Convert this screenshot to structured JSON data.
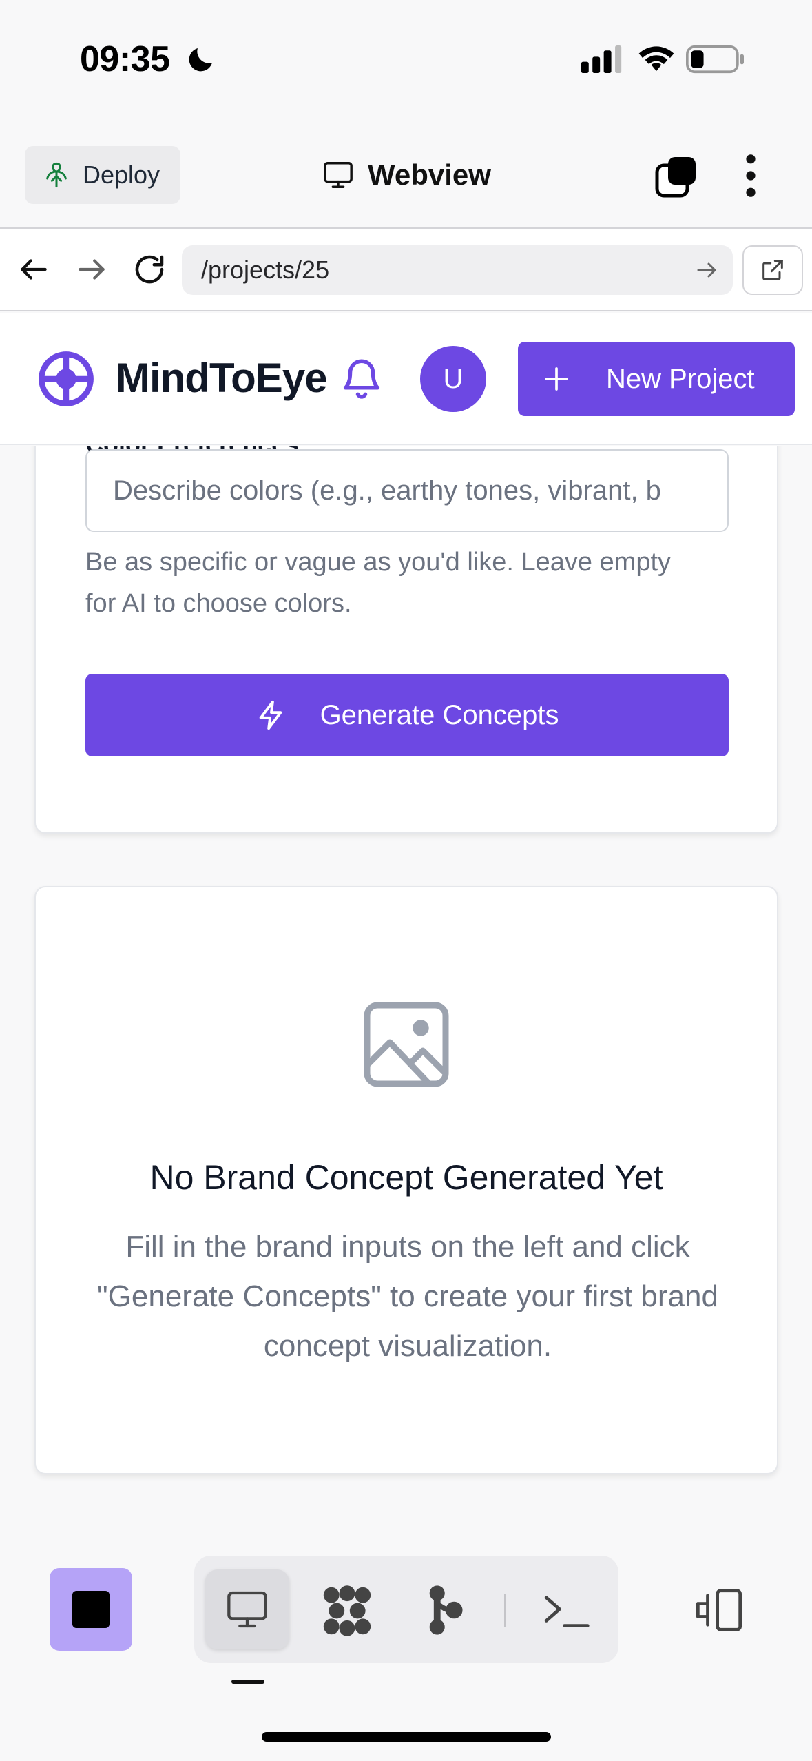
{
  "status_bar": {
    "time": "09:35"
  },
  "webview_header": {
    "deploy_label": "Deploy",
    "title": "Webview"
  },
  "browser": {
    "url": "/projects/25"
  },
  "app_header": {
    "brand": "MindToEye",
    "avatar_initial": "U",
    "new_project_label": "New Project"
  },
  "form": {
    "color_label": "Color Preferences",
    "color_placeholder": "Describe colors (e.g., earthy tones, vibrant, b",
    "color_help": "Be as specific or vague as you'd like. Leave empty for AI to choose colors.",
    "generate_label": "Generate Concepts"
  },
  "empty_state": {
    "title": "No Brand Concept Generated Yet",
    "description": "Fill in the brand inputs on the left and click \"Generate Concepts\" to create your first brand concept visualization."
  },
  "colors": {
    "accent": "#6d48e3",
    "accent_light": "#b5a3f7",
    "muted_text": "#6b7280"
  },
  "icons": [
    "moon-icon",
    "signal-icon",
    "wifi-icon",
    "battery-icon",
    "deploy-icon",
    "monitor-icon",
    "tabs-icon",
    "more-icon",
    "back-icon",
    "forward-icon",
    "reload-icon",
    "arrow-right-icon",
    "external-link-icon",
    "logo-icon",
    "bell-icon",
    "plus-icon",
    "lightning-icon",
    "image-icon",
    "stop-icon",
    "agents-icon",
    "git-icon",
    "shell-icon",
    "panel-toggle-icon"
  ]
}
